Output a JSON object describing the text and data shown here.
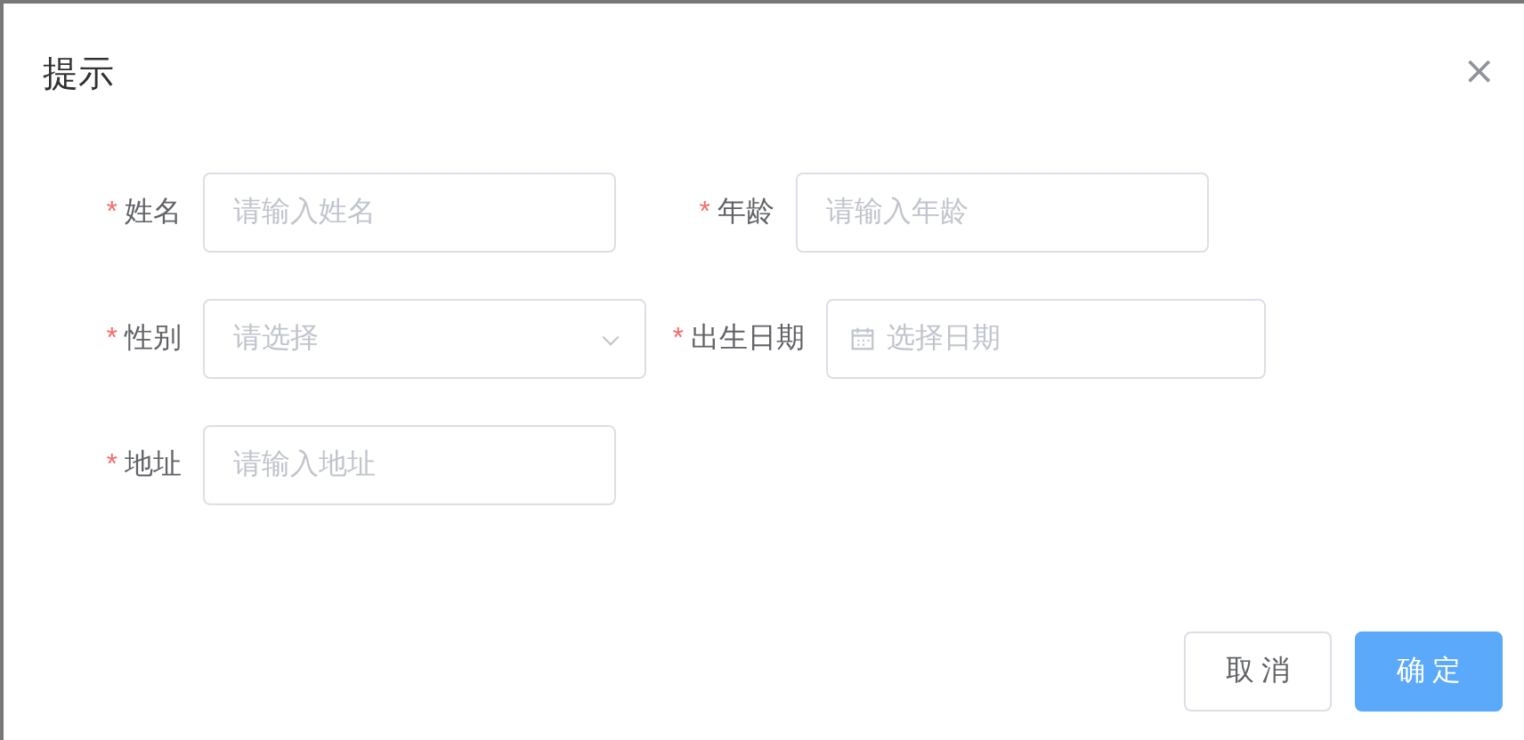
{
  "dialog": {
    "title": "提示",
    "close": "×"
  },
  "form": {
    "rows": [
      {
        "fields": [
          {
            "kind": "text",
            "required": true,
            "mark": "*",
            "label": "姓名",
            "placeholder": "请输入姓名"
          },
          {
            "kind": "text",
            "required": true,
            "mark": "*",
            "label": "年龄",
            "placeholder": "请输入年龄"
          }
        ]
      },
      {
        "fields": [
          {
            "kind": "select",
            "required": true,
            "mark": "*",
            "label": "性别",
            "placeholder": "请选择"
          },
          {
            "kind": "date",
            "required": true,
            "mark": "*",
            "label": "出生日期",
            "placeholder": "选择日期"
          }
        ]
      },
      {
        "fields": [
          {
            "kind": "text",
            "required": true,
            "mark": "*",
            "label": "地址",
            "placeholder": "请输入地址"
          }
        ]
      }
    ]
  },
  "buttons": [
    {
      "kind": "default",
      "label": "取 消"
    },
    {
      "kind": "primary",
      "label": "确 定"
    }
  ]
}
